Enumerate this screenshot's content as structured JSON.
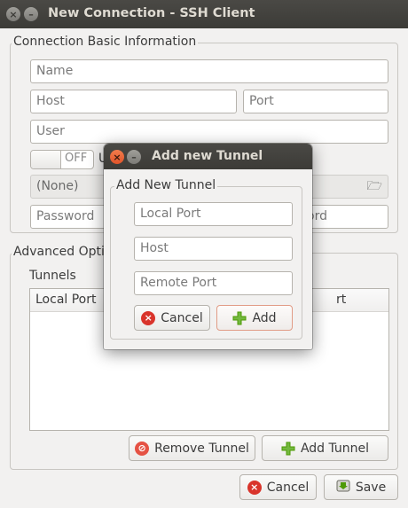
{
  "window": {
    "title": "New Connection - SSH Client"
  },
  "basic": {
    "section_label": "Connection Basic Information",
    "name_placeholder": "Name",
    "host_placeholder": "Host",
    "port_placeholder": "Port",
    "user_placeholder": "User",
    "toggle_state": "OFF",
    "toggle_trailing": "U",
    "key_value": "(None)",
    "password_placeholder": "Password",
    "password_confirm_partial": "ord"
  },
  "advanced": {
    "section_label": "Advanced Optio",
    "tunnels_label": "Tunnels",
    "columns": [
      "Local Port",
      "rt"
    ],
    "rows": [],
    "remove_tunnel_label": "Remove Tunnel",
    "add_tunnel_label": "Add Tunnel"
  },
  "footer": {
    "cancel_label": "Cancel",
    "save_label": "Save"
  },
  "dialog": {
    "title": "Add new Tunnel",
    "frame_label": "Add New Tunnel",
    "local_port_placeholder": "Local Port",
    "host_placeholder": "Host",
    "remote_port_placeholder": "Remote Port",
    "cancel_label": "Cancel",
    "add_label": "Add"
  },
  "icons": {
    "close": "close-icon",
    "minimize": "minimize-icon",
    "file": "file-browse-icon",
    "cancel": "cancel-icon",
    "remove": "no-entry-icon",
    "add": "plus-icon",
    "save": "save-icon"
  },
  "colors": {
    "titlebar": "#3c3b37",
    "close_button": "#e0542a",
    "plus_icon": "#4e9a06",
    "cancel_icon": "#d9342b",
    "default_button_border": "#e19c86"
  }
}
